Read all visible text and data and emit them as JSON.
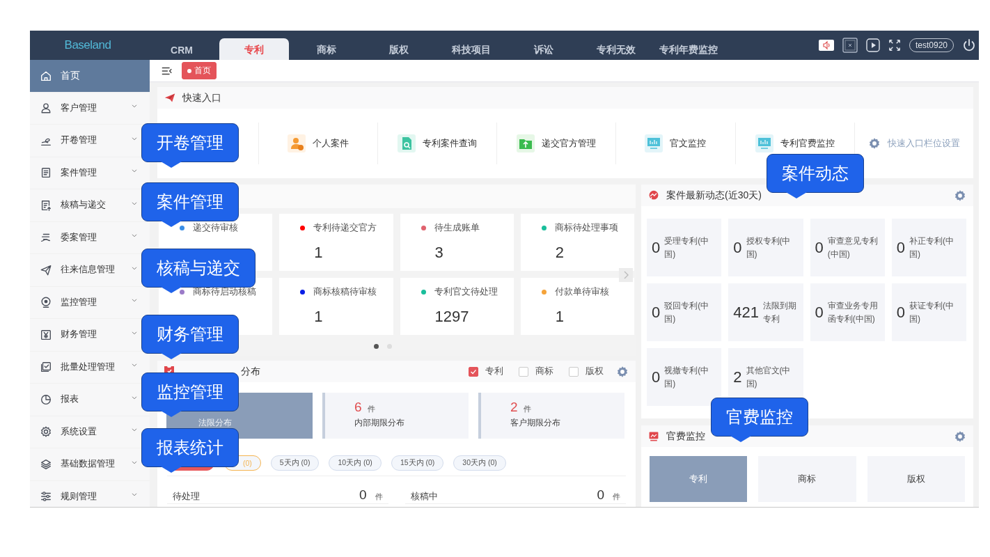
{
  "topbar": {
    "logo": "Baseland",
    "tabs": [
      {
        "label": "CRM",
        "selected": false
      },
      {
        "label": "专利",
        "selected": true
      },
      {
        "label": "商标",
        "selected": false
      },
      {
        "label": "版权",
        "selected": false
      },
      {
        "label": "科技项目",
        "selected": false
      },
      {
        "label": "诉讼",
        "selected": false
      },
      {
        "label": "专利无效",
        "selected": false
      },
      {
        "label": "专利年费监控",
        "selected": false
      }
    ],
    "user": "test0920"
  },
  "sidebar": {
    "items": [
      {
        "label": "首页",
        "selected": true
      },
      {
        "label": "客户管理",
        "selected": false
      },
      {
        "label": "开卷管理",
        "selected": false
      },
      {
        "label": "案件管理",
        "selected": false
      },
      {
        "label": "核稿与递交",
        "selected": false
      },
      {
        "label": "委案管理",
        "selected": false
      },
      {
        "label": "往来信息管理",
        "selected": false
      },
      {
        "label": "监控管理",
        "selected": false
      },
      {
        "label": "财务管理",
        "selected": false
      },
      {
        "label": "批量处理管理",
        "selected": false
      },
      {
        "label": "报表",
        "selected": false
      },
      {
        "label": "系统设置",
        "selected": false
      },
      {
        "label": "基础数据管理",
        "selected": false
      },
      {
        "label": "规则管理",
        "selected": false
      }
    ]
  },
  "breadcrumb": {
    "tags": [
      {
        "label": "首页",
        "selected": true
      }
    ]
  },
  "quick_entry": {
    "title": "快速入口",
    "items": [
      {
        "label": "个人案件"
      },
      {
        "label": "专利案件查询"
      },
      {
        "label": "递交官方管理"
      },
      {
        "label": "官文监控"
      },
      {
        "label": "专利官费监控"
      }
    ],
    "settings_link": "快速入口栏位设置"
  },
  "todo": {
    "cards": [
      {
        "label": "递交待审核",
        "color": "#3a8ee6"
      },
      {
        "label": "专利待递交官方",
        "color": "#ff0000",
        "value": "1"
      },
      {
        "label": "待生成账单",
        "color": "#e0626e",
        "value": "3"
      },
      {
        "label": "商标待处理事项",
        "color": "#19be9b",
        "value": "2"
      },
      {
        "label": "商标待启动核稿",
        "color": "#9b7bc8"
      },
      {
        "label": "商标核稿待审核",
        "color": "#0a1ee6",
        "value": "1"
      },
      {
        "label": "专利官文待处理",
        "color": "#19be9b",
        "value": "1297"
      },
      {
        "label": "付款单待审核",
        "color": "#f5a33a",
        "value": "1"
      }
    ],
    "pages": [
      {
        "selected": true
      },
      {
        "selected": false
      }
    ]
  },
  "case_distribution": {
    "title": "分布",
    "filters": [
      {
        "label": "专利",
        "checked": true
      },
      {
        "label": "商标",
        "checked": false
      },
      {
        "label": "版权",
        "checked": false
      }
    ],
    "deadline_cards": [
      {
        "label": "法限分布",
        "selected": true
      },
      {
        "value": "6",
        "unit": "件",
        "label": "内部期限分布",
        "selected": false
      },
      {
        "value": "2",
        "unit": "件",
        "label": "客户期限分布",
        "selected": false
      }
    ],
    "ranges": [
      {
        "selected": true,
        "color": "#e8585a"
      },
      {
        "label": "(0)",
        "selected": false,
        "color": "#f5b450"
      },
      {
        "label": "5天内 (0)",
        "selected": false,
        "color": "#d3dcec"
      },
      {
        "label": "10天内 (0)",
        "selected": false,
        "color": "#d3dcec"
      },
      {
        "label": "15天内 (0)",
        "selected": false,
        "color": "#d3dcec"
      },
      {
        "label": "30天内 (0)",
        "selected": false,
        "color": "#d3dcec"
      }
    ],
    "rows": [
      {
        "label": "待处理",
        "value": "0",
        "unit": "件"
      },
      {
        "label": "核稿中",
        "value": "0",
        "unit": "件"
      }
    ]
  },
  "case_activity": {
    "title": "案件最新动态(近30天)",
    "cells": [
      {
        "value": "0",
        "label": "受理专利(中国)"
      },
      {
        "value": "0",
        "label": "授权专利(中国)"
      },
      {
        "value": "0",
        "label": "审查意见专利(中国)"
      },
      {
        "value": "0",
        "label": "补正专利(中国)"
      },
      {
        "value": "0",
        "label": "驳回专利(中国)"
      },
      {
        "value": "421",
        "label": "法限到期专利"
      },
      {
        "value": "0",
        "label": "审查业务专用函专利(中国)"
      },
      {
        "value": "0",
        "label": "获证专利(中国)"
      },
      {
        "value": "0",
        "label": "视撤专利(中国)"
      },
      {
        "value": "2",
        "label": "其他官文(中国)"
      }
    ]
  },
  "fee_monitor": {
    "title": "官费监控",
    "tabs": [
      {
        "label": "专利",
        "selected": true
      },
      {
        "label": "商标",
        "selected": false
      },
      {
        "label": "版权",
        "selected": false
      }
    ]
  },
  "callouts": [
    {
      "text": "开卷管理"
    },
    {
      "text": "案件管理"
    },
    {
      "text": "核稿与递交"
    },
    {
      "text": "财务管理"
    },
    {
      "text": "监控管理"
    },
    {
      "text": "报表统计"
    },
    {
      "text": "案件动态"
    },
    {
      "text": "官费监控"
    }
  ]
}
